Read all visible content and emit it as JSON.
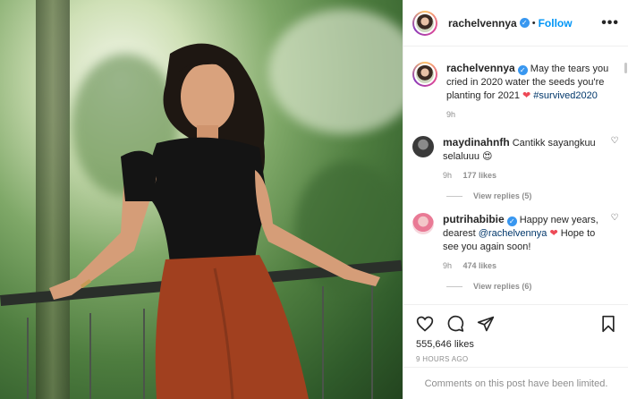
{
  "post": {
    "author": "rachelvennya",
    "verified_mark": "✓",
    "follow_label": "Follow",
    "separator": "•",
    "more_label": "•••"
  },
  "caption": {
    "username": "rachelvennya",
    "text": "May the tears you cried in 2020 water the seeds you're planting for 2021",
    "heart": "❤",
    "hashtag": "#survived2020",
    "time": "9h"
  },
  "comments": [
    {
      "username": "maydinahnfh",
      "text": "Cantikk sayangkuu selaluuu",
      "emoji": "😍",
      "time": "9h",
      "likes": "177 likes",
      "view_replies": "View replies (5)"
    },
    {
      "username": "putrihabibie",
      "text_before": "Happy new years, dearest",
      "mention": "@rachelvennya",
      "heart": "❤",
      "text_after": "Hope to see you again soon!",
      "time": "9h",
      "likes": "474 likes",
      "view_replies": "View replies (6)"
    }
  ],
  "footer": {
    "likes": "555,646 likes",
    "timestamp": "9 HOURS AGO",
    "limited": "Comments on this post have been limited."
  },
  "icons": {
    "like": "heart-icon",
    "comment": "comment-icon",
    "share": "paper-plane-icon",
    "save": "bookmark-icon"
  },
  "colors": {
    "accent": "#0095f6",
    "verified": "#3897f0",
    "muted": "#8e8e8e",
    "heart_red": "#ed4956"
  }
}
